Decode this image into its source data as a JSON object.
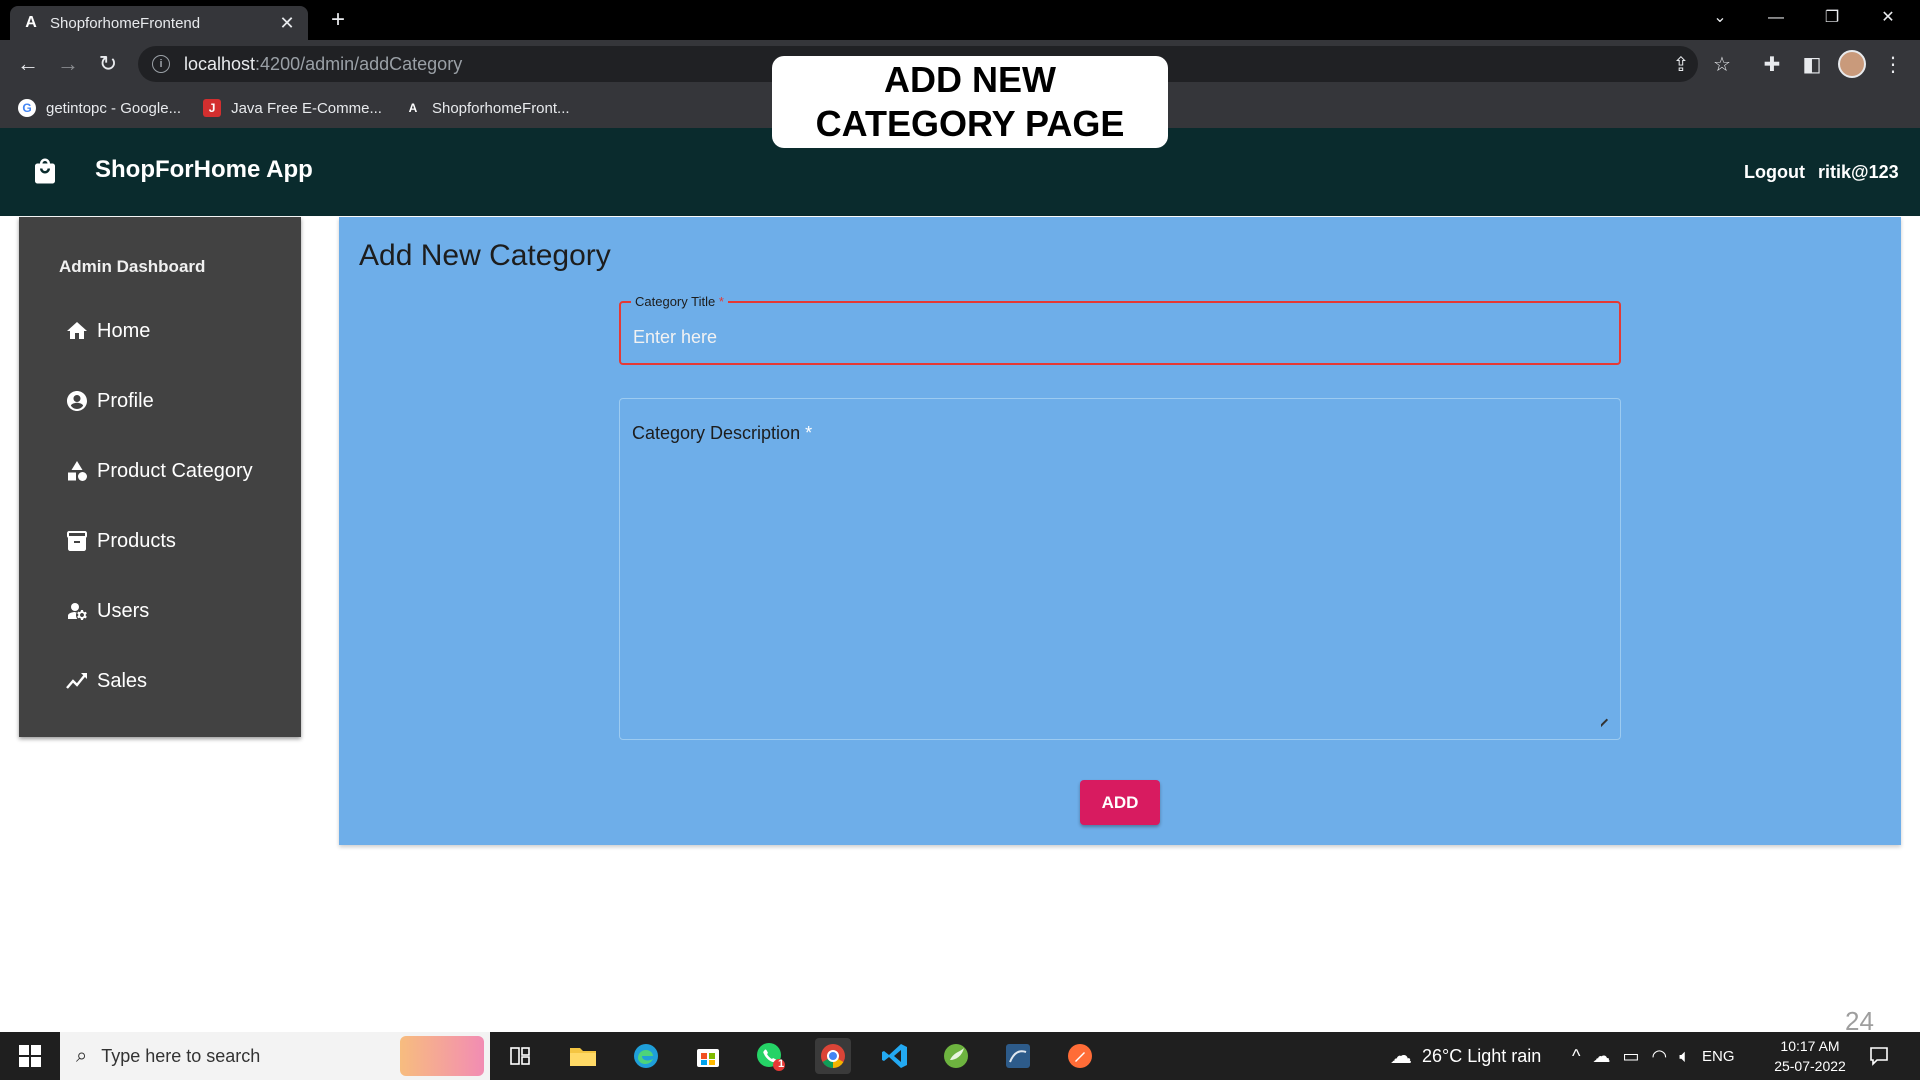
{
  "browser": {
    "tab_title": "ShopforhomeFrontend",
    "url_host": "localhost",
    "url_path": ":4200/admin/addCategory",
    "bookmarks": [
      {
        "label": "getintopc - Google...",
        "icon": "google-icon"
      },
      {
        "label": "Java Free E-Comme...",
        "icon": "java-icon"
      },
      {
        "label": "ShopforhomeFront...",
        "icon": "angular-icon"
      }
    ]
  },
  "overlay": {
    "line1": "ADD NEW",
    "line2": "CATEGORY PAGE"
  },
  "header": {
    "brand": "ShopForHome App",
    "logout": "Logout",
    "username": "ritik@123"
  },
  "sidebar": {
    "title": "Admin Dashboard",
    "items": [
      {
        "label": "Home",
        "icon": "home-icon"
      },
      {
        "label": "Profile",
        "icon": "account-circle-icon"
      },
      {
        "label": "Product Category",
        "icon": "category-icon"
      },
      {
        "label": "Products",
        "icon": "inventory-icon"
      },
      {
        "label": "Users",
        "icon": "manage-accounts-icon"
      },
      {
        "label": "Sales",
        "icon": "trending-up-icon"
      }
    ]
  },
  "form": {
    "heading": "Add New Category",
    "title_label": "Category Title",
    "title_required": "*",
    "title_placeholder": "Enter here",
    "description_label": "Category Description",
    "description_required": "*",
    "submit_label": "ADD"
  },
  "page_number": "24",
  "taskbar": {
    "search_placeholder": "Type here to search",
    "weather": "26°C  Light rain",
    "language": "ENG",
    "time": "10:17 AM",
    "date": "25-07-2022",
    "whatsapp_badge": "1"
  },
  "colors": {
    "header_bg": "#0a2b2d",
    "sidebar_bg": "#424242",
    "card_bg": "#6eaee9",
    "accent_button": "#d81b60",
    "error_border": "#e53935"
  }
}
